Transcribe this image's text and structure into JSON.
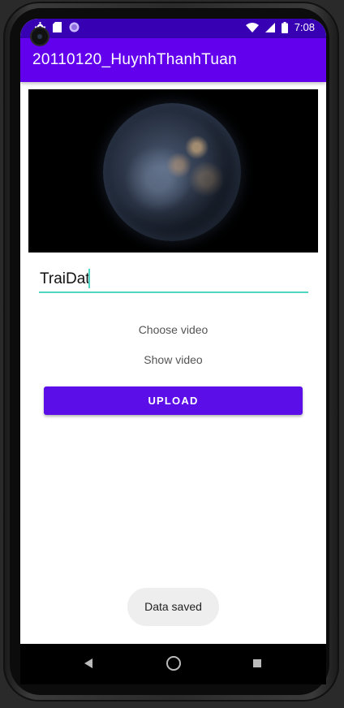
{
  "status_bar": {
    "time": "7:08",
    "icons": [
      "settings-icon",
      "sd-card-icon",
      "circle-app-icon",
      "wifi-icon",
      "signal-icon",
      "battery-icon"
    ]
  },
  "app_bar": {
    "title": "20110120_HuynhThanhTuan"
  },
  "video": {
    "content": "earth-at-night"
  },
  "name_field": {
    "value": "TraiDat"
  },
  "buttons": {
    "choose_video": "Choose video",
    "show_video": "Show video",
    "upload": "UPLOAD"
  },
  "toast": {
    "message": "Data saved"
  },
  "colors": {
    "primary": "#6200ee",
    "primary_dark": "#3700b3",
    "accent": "#4fd6c4",
    "upload_button": "#5b0ee8"
  },
  "nav_bar": {
    "icons": [
      "back-icon",
      "home-icon",
      "recents-icon"
    ]
  }
}
